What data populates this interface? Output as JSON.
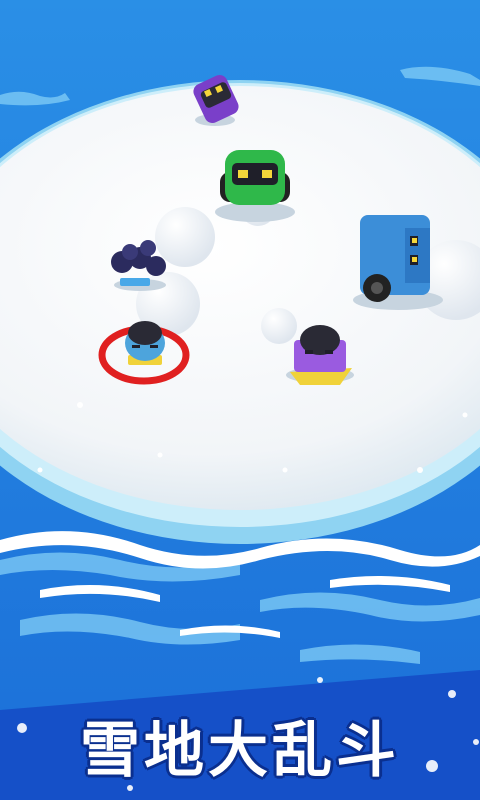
{
  "title": "雪地大乱斗",
  "colors": {
    "ocean": "#1e88e0",
    "ocean_light": "#5fc0f5",
    "snow": "#f6f8fa",
    "banner": "#1550c8",
    "title_outline": "#0a2f8f",
    "target_ring": "#e02020"
  }
}
